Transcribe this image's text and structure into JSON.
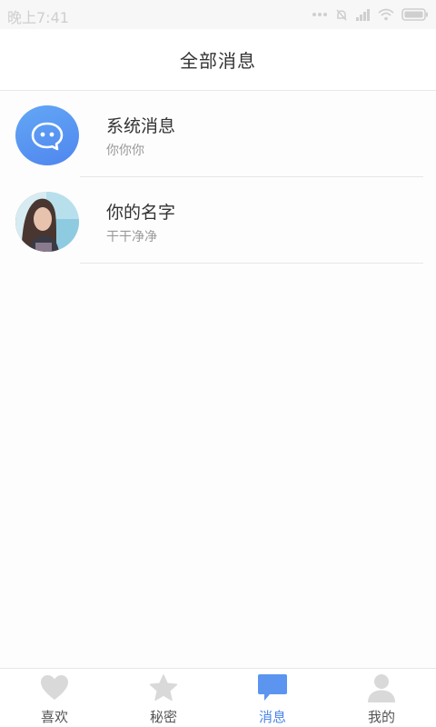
{
  "status_bar": {
    "time": "晚上7:41"
  },
  "header": {
    "title": "全部消息"
  },
  "messages": [
    {
      "name": "系统消息",
      "preview": "你你你",
      "avatar": "system-chat-face-icon"
    },
    {
      "name": "你的名字",
      "preview": "干干净净",
      "avatar": "user-photo"
    }
  ],
  "tabs": [
    {
      "label": "喜欢",
      "icon": "heart-icon",
      "active": false
    },
    {
      "label": "秘密",
      "icon": "star-icon",
      "active": false
    },
    {
      "label": "消息",
      "icon": "message-bubble-icon",
      "active": true
    },
    {
      "label": "我的",
      "icon": "person-icon",
      "active": false
    }
  ],
  "colors": {
    "accent": "#4a86e8",
    "inactive_icon": "#d9d9d9"
  }
}
